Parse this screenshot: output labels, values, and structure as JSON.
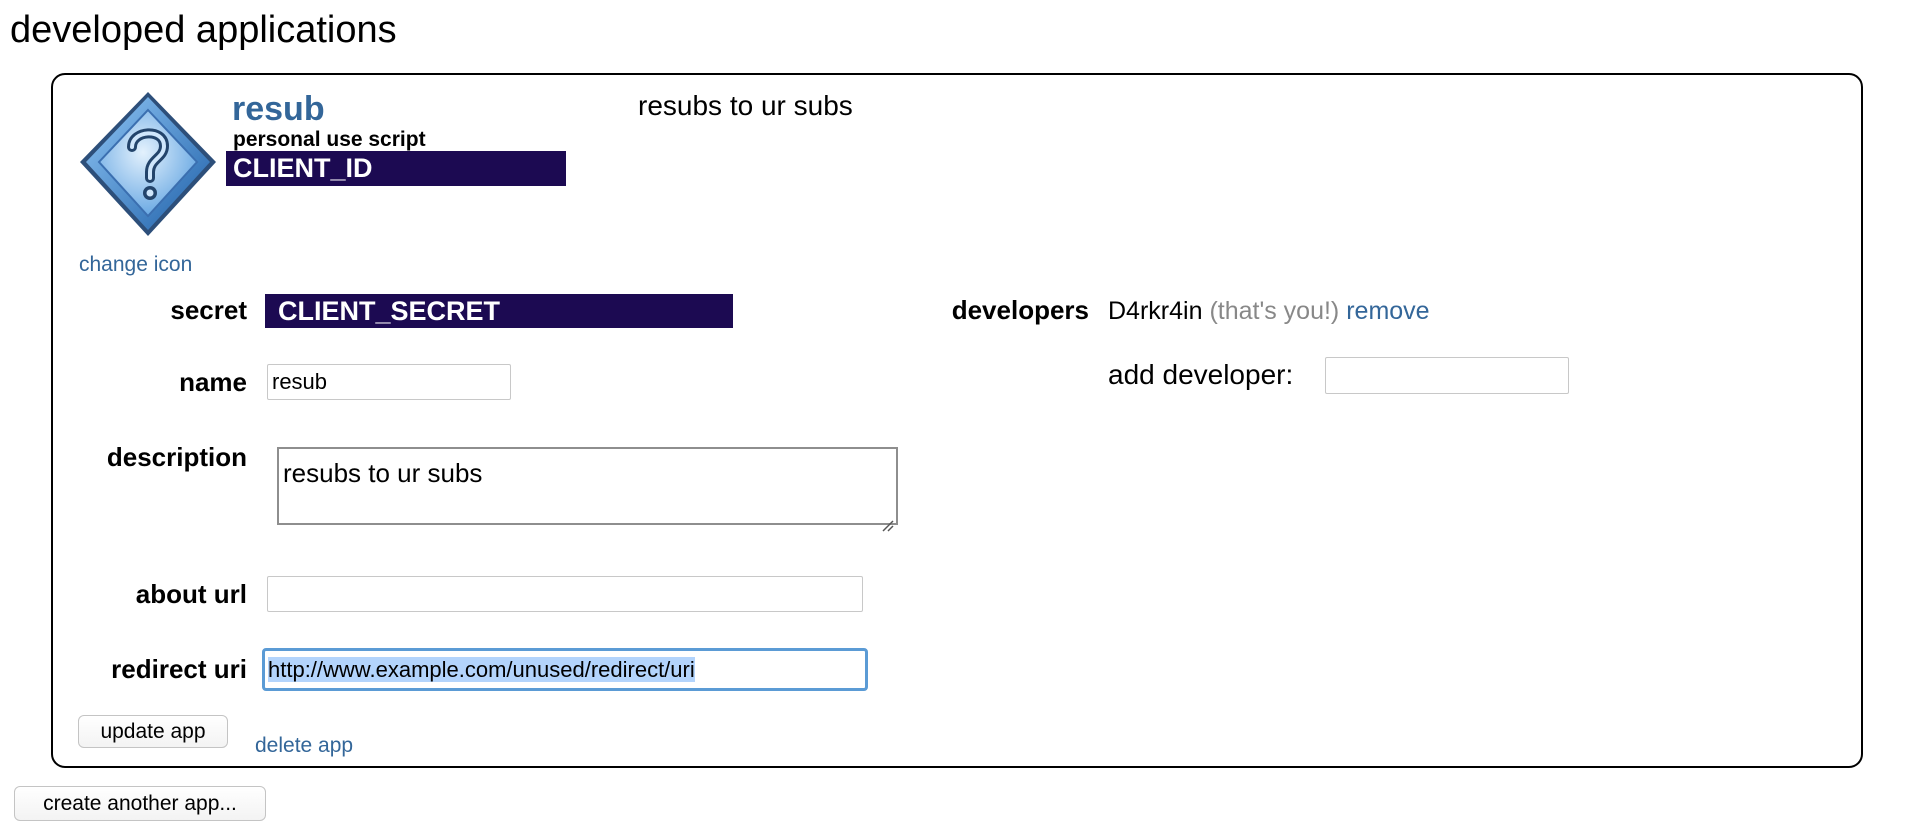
{
  "page": {
    "heading": "developed applications"
  },
  "app": {
    "name": "resub",
    "type": "personal use script",
    "client_id": "CLIENT_ID",
    "description_display": "resubs to ur subs",
    "change_icon_label": "change icon",
    "icon": "question-mark-diamond-icon"
  },
  "form": {
    "secret_label": "secret",
    "secret_value": "CLIENT_SECRET",
    "name_label": "name",
    "name_value": "resub",
    "description_label": "description",
    "description_value": "resubs to ur subs",
    "about_url_label": "about url",
    "about_url_value": "",
    "redirect_uri_label": "redirect uri",
    "redirect_uri_value": "http://www.example.com/unused/redirect/uri",
    "update_button_label": "update app",
    "delete_link_label": "delete app"
  },
  "developers": {
    "label": "developers",
    "username": "D4rkr4in",
    "you_note": "(that's you!)",
    "remove_label": "remove",
    "add_label": "add developer:",
    "add_value": ""
  },
  "actions": {
    "create_another_label": "create another app..."
  },
  "colors": {
    "link": "#336699",
    "redacted_bg": "#1c0a52",
    "focus_ring": "#5b9bd5",
    "selection": "#b3d4fc"
  }
}
